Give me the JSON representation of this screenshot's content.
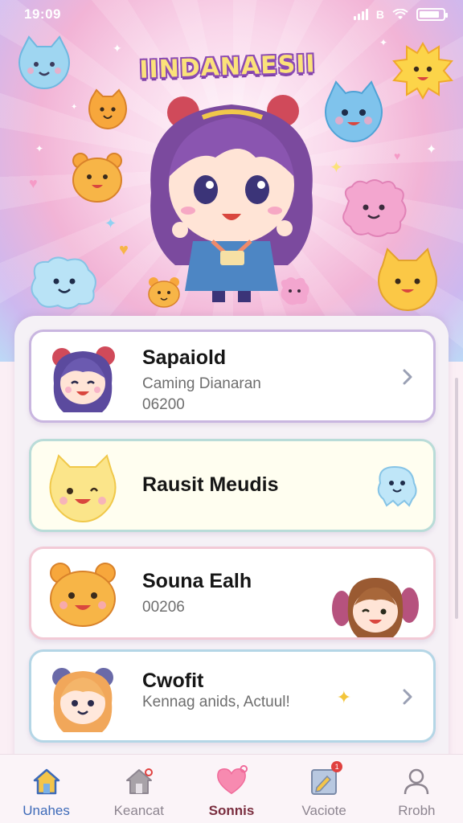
{
  "status_bar": {
    "time": "19:09",
    "carrier": "B",
    "battery_level": 0.85
  },
  "app": {
    "title": "IINDANAESII"
  },
  "cards": [
    {
      "title": "Sapaiold",
      "subtitle": "Caming Dianaran",
      "number": "06200",
      "avatar_icon": "anime-girl-purple-hair-icon",
      "has_chevron": true
    },
    {
      "title": "Rausit Meudis",
      "subtitle": "",
      "number": "",
      "avatar_icon": "yellow-cat-icon",
      "deco_icon": "blue-ghost-icon",
      "has_chevron": false
    },
    {
      "title": "Souna Ealh",
      "subtitle": "",
      "number": "00206",
      "avatar_icon": "orange-bear-icon",
      "deco_icon": "anime-girl-pigtails-icon",
      "has_chevron": false
    },
    {
      "title": "Cwofit",
      "subtitle": "Kennag anids, Actuul!",
      "number": "",
      "avatar_icon": "anime-girl-blonde-icon",
      "deco_icon": "sparkle-icon",
      "has_chevron": true
    }
  ],
  "nav": [
    {
      "label": "Unahes",
      "icon": "home-icon",
      "active": true
    },
    {
      "label": "Keancat",
      "icon": "house-outline-icon",
      "active": false
    },
    {
      "label": "Sonnis",
      "icon": "heart-icon",
      "active": false
    },
    {
      "label": "Vaciote",
      "icon": "notes-icon",
      "active": false,
      "badge": true
    },
    {
      "label": "Rrobh",
      "icon": "profile-icon",
      "active": false
    }
  ],
  "colors": {
    "accent": "#3d6ab8",
    "hero_pink": "#f2b4d6",
    "title_yellow": "#fbe27a",
    "title_outline": "#8c4bb3"
  }
}
